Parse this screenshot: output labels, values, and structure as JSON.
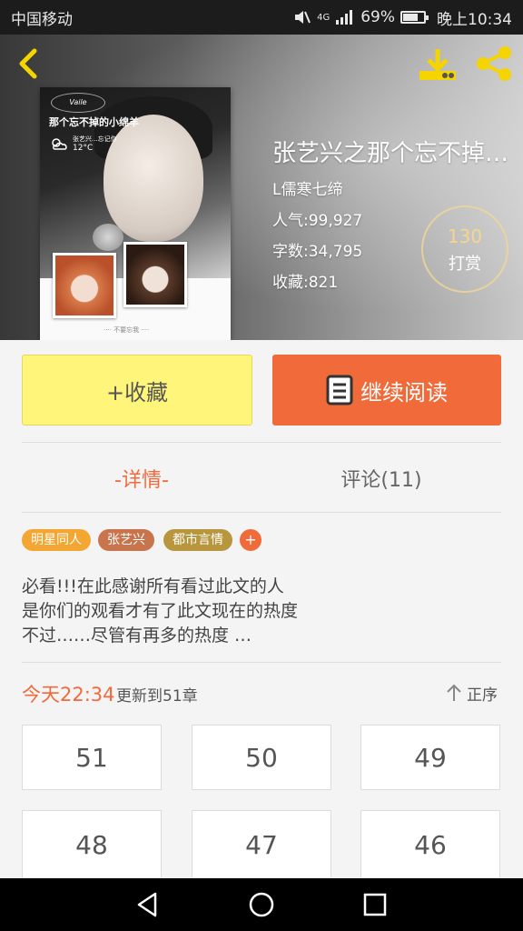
{
  "status_bar": {
    "carrier": "中国移动",
    "network": "4G",
    "battery": "69%",
    "time": "晚上10:34"
  },
  "book": {
    "title": "张艺兴之那个忘不掉…",
    "author": "L儒寒七缔",
    "popularity": "人气:99,927",
    "word_count": "字数:34,795",
    "favorites": "收藏:821",
    "tip_count": "130",
    "tip_label": "打赏",
    "cover": {
      "title": "那个忘不掉的小绵羊",
      "weather_text": "12°C",
      "weather_sub": "张艺兴...忘记你",
      "footer": "····  不要忘我  ····"
    }
  },
  "actions": {
    "favorite_label": "+收藏",
    "read_label": "继续阅读"
  },
  "tabs": [
    {
      "label": "-详情-",
      "active": true
    },
    {
      "label": "评论(11)",
      "active": false
    }
  ],
  "tags": [
    "明星同人",
    "张艺兴",
    "都市言情"
  ],
  "tag_add": "+",
  "description": {
    "line1": "必看!!!在此感谢所有看过此文的人",
    "line2": "是你们的观看才有了此文现在的热度",
    "line3": "不过……尽管有再多的热度 …"
  },
  "update": {
    "time": "今天22:34",
    "text": "更新到51章",
    "sort_label": "正序"
  },
  "chapters": [
    "51",
    "50",
    "49",
    "48",
    "47",
    "46"
  ],
  "colors": {
    "accent": "#f06a3a",
    "favorite_button": "#fff57a",
    "tag_orange": "#f3a631",
    "tag_brown": "#c8744c",
    "tag_olive": "#b8963e"
  },
  "icons": [
    "back-arrow-icon",
    "download-icon",
    "share-icon",
    "book-icon",
    "arrow-up-icon",
    "nav-back-icon",
    "nav-home-icon",
    "nav-recents-icon"
  ]
}
